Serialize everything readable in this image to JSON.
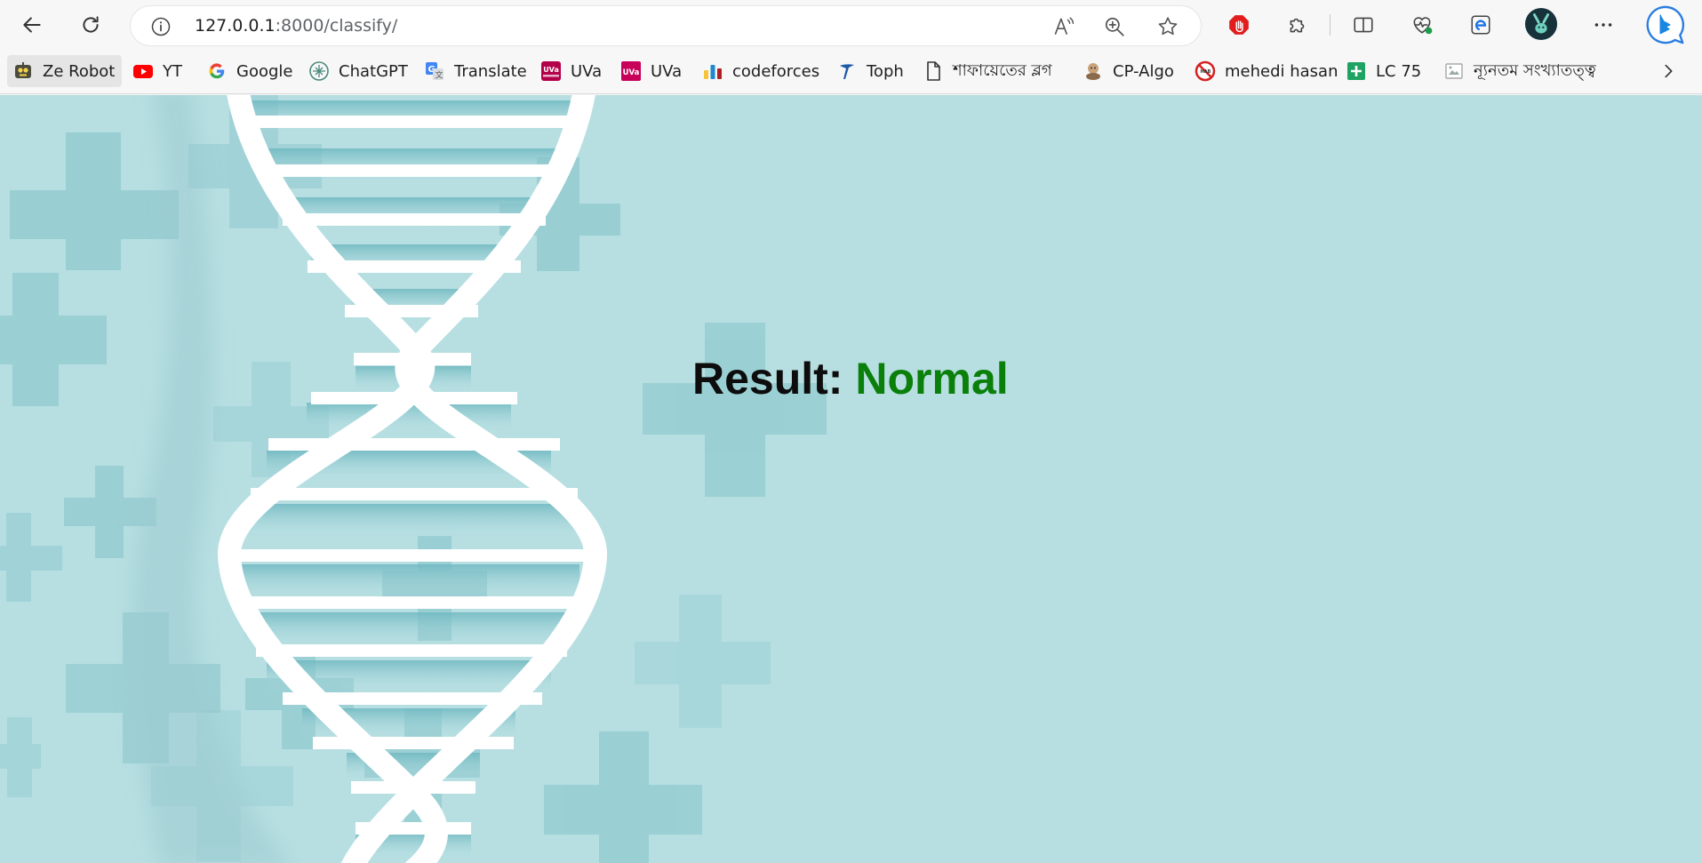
{
  "browser": {
    "url_host": "127.0.0.1",
    "url_rest": ":8000/classify/",
    "icons": {
      "back": "back-arrow-icon",
      "reload": "reload-icon",
      "site_info": "info-icon",
      "read_aloud": "read-aloud-icon",
      "zoom": "zoom-icon",
      "favorite": "star-icon",
      "adblock": "stop-hand-icon",
      "extensions": "puzzle-icon",
      "split_screen": "split-screen-icon",
      "health": "heart-pulse-icon",
      "ie_mode": "ie-icon",
      "profile": "avatar",
      "more": "more-icon",
      "copilot": "copilot-icon"
    }
  },
  "bookmarks": [
    {
      "label": "Ze Robot",
      "icon": "robot-icon"
    },
    {
      "label": "YT",
      "icon": "youtube-icon"
    },
    {
      "label": "Google",
      "icon": "google-icon"
    },
    {
      "label": "ChatGPT",
      "icon": "chatgpt-icon"
    },
    {
      "label": "Translate",
      "icon": "translate-icon"
    },
    {
      "label": "UVa",
      "icon": "uva-hunting-icon"
    },
    {
      "label": "UVa",
      "icon": "uva-icon"
    },
    {
      "label": "codeforces",
      "icon": "codeforces-icon"
    },
    {
      "label": "Toph",
      "icon": "toph-icon"
    },
    {
      "label": "শাফায়েতের ব্লগ",
      "icon": "document-icon"
    },
    {
      "label": "CP-Algo",
      "icon": "cp-algo-icon"
    },
    {
      "label": "mehedi hasan",
      "icon": "no-sign-icon"
    },
    {
      "label": "LC 75",
      "icon": "plus-sheet-icon"
    },
    {
      "label": "ন্যূনতম সংখ্যাতত্ত্ব",
      "icon": "image-icon"
    }
  ],
  "colors": {
    "page_bg": "#b7dfe2",
    "result_label": "#0d0d0d",
    "result_value": "#0a7f0a"
  },
  "result": {
    "label": "Result:",
    "value": "Normal"
  }
}
